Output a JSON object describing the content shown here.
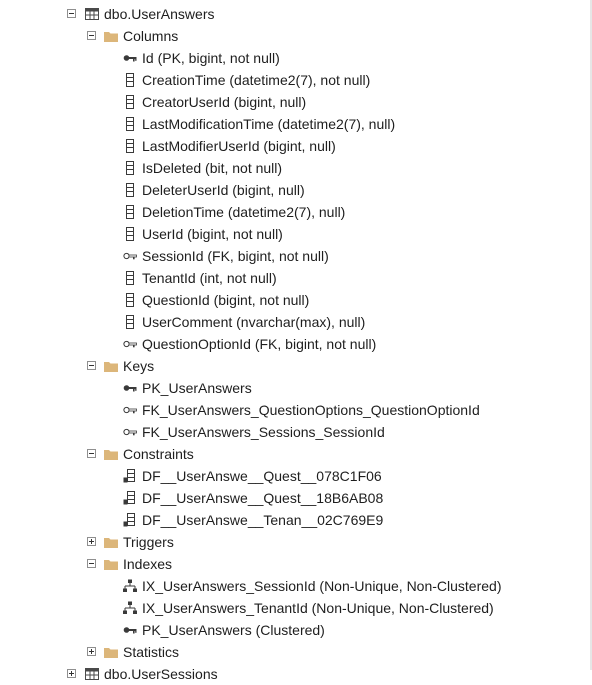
{
  "table": {
    "label": "dbo.UserAnswers"
  },
  "folders": {
    "columns": "Columns",
    "keys": "Keys",
    "constraints": "Constraints",
    "triggers": "Triggers",
    "indexes": "Indexes",
    "statistics": "Statistics"
  },
  "columns": [
    "Id (PK, bigint, not null)",
    "CreationTime (datetime2(7), not null)",
    "CreatorUserId (bigint, null)",
    "LastModificationTime (datetime2(7), null)",
    "LastModifierUserId (bigint, null)",
    "IsDeleted (bit, not null)",
    "DeleterUserId (bigint, null)",
    "DeletionTime (datetime2(7), null)",
    "UserId (bigint, not null)",
    "SessionId (FK, bigint, not null)",
    "TenantId (int, not null)",
    "QuestionId (bigint, not null)",
    "UserComment (nvarchar(max), null)",
    "QuestionOptionId (FK, bigint, not null)"
  ],
  "keys": [
    "PK_UserAnswers",
    "FK_UserAnswers_QuestionOptions_QuestionOptionId",
    "FK_UserAnswers_Sessions_SessionId"
  ],
  "constraints": [
    "DF__UserAnswe__Quest__078C1F06",
    "DF__UserAnswe__Quest__18B6AB08",
    "DF__UserAnswe__Tenan__02C769E9"
  ],
  "indexes": [
    "IX_UserAnswers_SessionId (Non-Unique, Non-Clustered)",
    "IX_UserAnswers_TenantId (Non-Unique, Non-Clustered)",
    "PK_UserAnswers (Clustered)"
  ],
  "next_table": {
    "label": "dbo.UserSessions"
  },
  "icon_names": {
    "table": "table-icon",
    "folder": "folder-icon",
    "primary_key": "primary-key-icon",
    "foreign_key": "foreign-key-icon",
    "column": "column-icon",
    "constraint": "constraint-icon",
    "index": "index-icon"
  }
}
